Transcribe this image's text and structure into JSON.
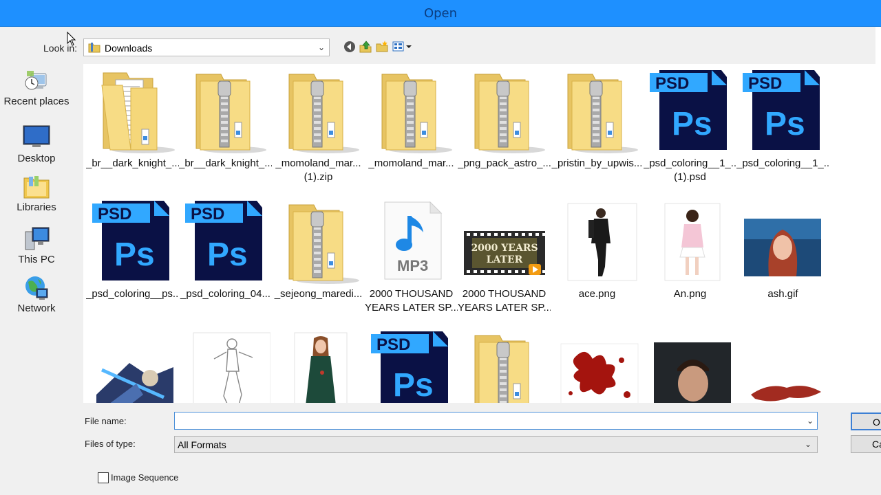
{
  "window": {
    "title": "Open"
  },
  "lookin": {
    "label": "Look in:",
    "value": "Downloads"
  },
  "places": [
    {
      "label": "Recent places",
      "icon": "recent-places-icon"
    },
    {
      "label": "Desktop",
      "icon": "desktop-icon"
    },
    {
      "label": "Libraries",
      "icon": "libraries-icon"
    },
    {
      "label": "This PC",
      "icon": "this-pc-icon"
    },
    {
      "label": "Network",
      "icon": "network-icon"
    }
  ],
  "files": [
    {
      "name": "_br__dark_knight_...",
      "name2": "",
      "kind": "folder"
    },
    {
      "name": "_br__dark_knight_...",
      "name2": "",
      "kind": "zip"
    },
    {
      "name": "_momoland_mar...",
      "name2": "(1).zip",
      "kind": "zip"
    },
    {
      "name": "_momoland_mar...",
      "name2": "",
      "kind": "zip"
    },
    {
      "name": "_png_pack_astro_...",
      "name2": "",
      "kind": "zip"
    },
    {
      "name": "_pristin_by_upwis...",
      "name2": "",
      "kind": "zip"
    },
    {
      "name": "_psd_coloring__1_...",
      "name2": "(1).psd",
      "kind": "psd"
    },
    {
      "name": "_psd_coloring__1_...",
      "name2": "",
      "kind": "psd"
    },
    {
      "name": "_psd_coloring__ps...",
      "name2": "",
      "kind": "psd"
    },
    {
      "name": "_psd_coloring_04...",
      "name2": "",
      "kind": "psd"
    },
    {
      "name": "_sejeong_maredi...",
      "name2": "",
      "kind": "zip"
    },
    {
      "name": "2000 THOUSAND",
      "name2": "YEARS LATER SP...",
      "kind": "mp3"
    },
    {
      "name": "2000 THOUSAND",
      "name2": "YEARS LATER SP...",
      "kind": "video"
    },
    {
      "name": "ace.png",
      "name2": "",
      "kind": "image-man"
    },
    {
      "name": "An.png",
      "name2": "",
      "kind": "image-woman"
    },
    {
      "name": "ash.gif",
      "name2": "",
      "kind": "image-portrait"
    },
    {
      "name": "",
      "name2": "",
      "kind": "image-action"
    },
    {
      "name": "",
      "name2": "",
      "kind": "image-sketch"
    },
    {
      "name": "",
      "name2": "",
      "kind": "image-dress"
    },
    {
      "name": "",
      "name2": "",
      "kind": "psd"
    },
    {
      "name": "",
      "name2": "",
      "kind": "zip"
    },
    {
      "name": "",
      "name2": "",
      "kind": "image-splatter"
    },
    {
      "name": "",
      "name2": "",
      "kind": "image-face"
    },
    {
      "name": "",
      "name2": "",
      "kind": "image-blood"
    }
  ],
  "psd_badge": "PSD",
  "ps_text": "Ps",
  "mp3_text": "MP3",
  "video_text": {
    "line1": "2000 YEARS",
    "line2": "LATER"
  },
  "filename": {
    "label": "File name:",
    "value": ""
  },
  "filetype": {
    "label": "Files of type:",
    "value": "All Formats"
  },
  "buttons": {
    "ok": "OK",
    "cancel": "Cancel"
  },
  "image_sequence": {
    "label": "Image Sequence",
    "checked": false
  },
  "colors": {
    "titlebar": "#1e90ff",
    "folder": "#f5d77a",
    "psd": "#001c52",
    "psd_accent": "#31a8ff"
  }
}
